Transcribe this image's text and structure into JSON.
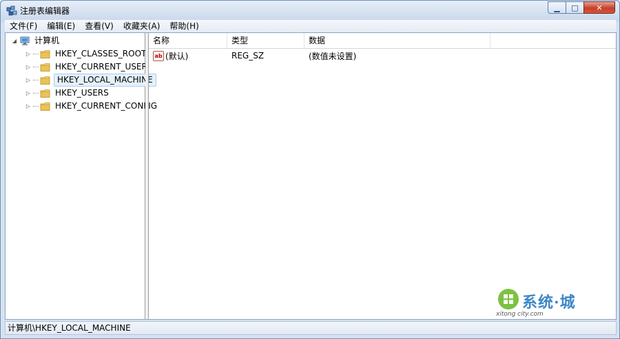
{
  "window": {
    "title": "注册表编辑器",
    "min_glyph": "▁",
    "max_glyph": "□",
    "close_glyph": "✕"
  },
  "menu": [
    {
      "label": "文件(F)"
    },
    {
      "label": "编辑(E)"
    },
    {
      "label": "查看(V)"
    },
    {
      "label": "收藏夹(A)"
    },
    {
      "label": "帮助(H)"
    }
  ],
  "tree": {
    "root": {
      "label": "计算机",
      "expander": "◢"
    },
    "items": [
      {
        "label": "HKEY_CLASSES_ROOT",
        "expander": "▷"
      },
      {
        "label": "HKEY_CURRENT_USER",
        "expander": "▷"
      },
      {
        "label": "HKEY_LOCAL_MACHINE",
        "expander": "▷",
        "selected": true
      },
      {
        "label": "HKEY_USERS",
        "expander": "▷"
      },
      {
        "label": "HKEY_CURRENT_CONFIG",
        "expander": "▷"
      }
    ]
  },
  "list": {
    "columns": [
      "名称",
      "类型",
      "数据"
    ],
    "rows": [
      {
        "icon_text": "ab",
        "name": "(默认)",
        "type": "REG_SZ",
        "data": "(数值未设置)"
      }
    ]
  },
  "status": {
    "path": "计算机\\HKEY_LOCAL_MACHINE"
  },
  "watermark": {
    "text": "系统·城",
    "url": "xitong city.com"
  },
  "colors": {
    "selection_bg": "#e5f0fb",
    "folder": "#e8c35a",
    "close_button": "#c7402b",
    "watermark_green": "#7cc242",
    "watermark_blue": "#3c86c6"
  }
}
